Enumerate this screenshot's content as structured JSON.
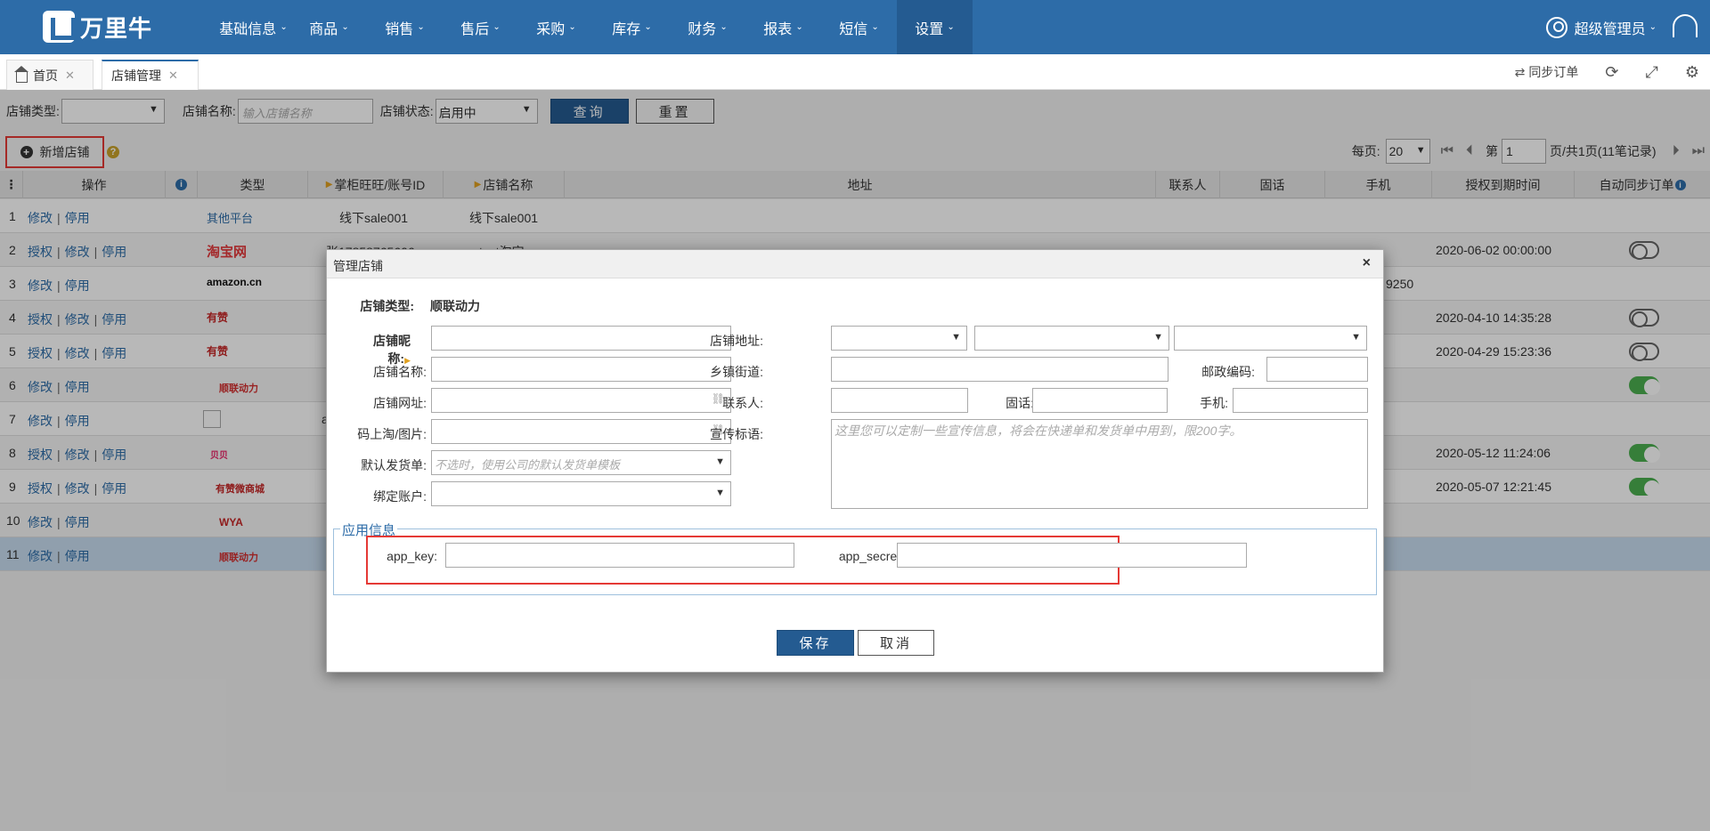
{
  "brand": {
    "name": "万里牛"
  },
  "nav": {
    "items": [
      {
        "label": "基础信息"
      },
      {
        "label": "商品"
      },
      {
        "label": "销售"
      },
      {
        "label": "售后"
      },
      {
        "label": "采购"
      },
      {
        "label": "库存"
      },
      {
        "label": "财务"
      },
      {
        "label": "报表"
      },
      {
        "label": "短信"
      },
      {
        "label": "设置"
      }
    ],
    "caret": "⌄",
    "user": "超级管理员"
  },
  "tabs": {
    "home": "首页",
    "active": "店铺管理",
    "close": "✕",
    "tools": {
      "sync": "同步订单",
      "refresh": "⟳",
      "fullscreen": "⤢",
      "settings": "⚙"
    }
  },
  "filter": {
    "type_label": "店铺类型:",
    "name_label": "店铺名称:",
    "name_placeholder": "输入店铺名称",
    "status_label": "店铺状态:",
    "status_value": "启用中",
    "query": "查询",
    "reset": "重置"
  },
  "toolbar": {
    "add": "新增店铺",
    "help": "?"
  },
  "pager": {
    "per_page_label": "每页:",
    "per_page": "20",
    "page_prefix": "第",
    "page": "1",
    "page_suffix": "页/共1页(11笔记录)",
    "first": "⏮",
    "prev": "⏴",
    "next": "⏵",
    "last": "⏭"
  },
  "table": {
    "headers": {
      "menu": "⋮",
      "ops": "操作",
      "info": "i",
      "type": "类型",
      "account": "掌柜旺旺/账号ID",
      "shop": "店铺名称",
      "addr": "地址",
      "contact": "联系人",
      "phone": "固话",
      "mobile": "手机",
      "expire": "授权到期时间",
      "autosync": "自动同步订单"
    },
    "op_labels": {
      "auth": "授权",
      "edit": "修改",
      "disable": "停用",
      "sep": "|"
    },
    "rows": [
      {
        "num": "1",
        "platform": "其他平台",
        "account": "线下sale001",
        "shop": "线下sale001",
        "expire": "",
        "mobile": ""
      },
      {
        "num": "2",
        "platform": "淘宝网",
        "account": "张17858765606",
        "shop": "test淘宝",
        "expire": "2020-06-02 00:00:00",
        "mobile": ""
      },
      {
        "num": "3",
        "platform": "amazon.cn",
        "account": "",
        "shop": "",
        "expire": "",
        "mobile": "9250"
      },
      {
        "num": "4",
        "platform": "有赞",
        "account": "",
        "shop": "",
        "expire": "2020-04-10 14:35:28",
        "mobile": ""
      },
      {
        "num": "5",
        "platform": "有赞",
        "account": "",
        "shop": "",
        "expire": "2020-04-29 15:23:36",
        "mobile": ""
      },
      {
        "num": "6",
        "platform": "顺联动力",
        "account": "",
        "shop": "",
        "expire": "",
        "mobile": ""
      },
      {
        "num": "7",
        "platform": "",
        "account": "a",
        "shop": "",
        "expire": "",
        "mobile": ""
      },
      {
        "num": "8",
        "platform": "贝贝",
        "account": "",
        "shop": "",
        "expire": "2020-05-12 11:24:06",
        "mobile": ""
      },
      {
        "num": "9",
        "platform": "有赞微商城",
        "account": "",
        "shop": "",
        "expire": "2020-05-07 12:21:45",
        "mobile": ""
      },
      {
        "num": "10",
        "platform": "WYA",
        "account": "",
        "shop": "",
        "expire": "",
        "mobile": ""
      },
      {
        "num": "11",
        "platform": "顺联动力",
        "account": "",
        "shop": "",
        "expire": "",
        "mobile": ""
      }
    ]
  },
  "dialog": {
    "title": "管理店铺",
    "close": "×",
    "type_label": "店铺类型:",
    "type_value": "顺联动力",
    "nick_label": "店铺昵称:",
    "name_label": "店铺名称:",
    "url_label": "店铺网址:",
    "qr_label": "码上淘/图片:",
    "invoice_label": "默认发货单:",
    "invoice_placeholder": "不选时，使用公司的默认发货单模板",
    "account_label": "绑定账户:",
    "addr_label": "店铺地址:",
    "street_label": "乡镇街道:",
    "zip_label": "邮政编码:",
    "contact_label": "联系人:",
    "phone_label": "固话:",
    "mobile_label": "手机:",
    "slogan_label": "宣传标语:",
    "slogan_placeholder": "这里您可以定制一些宣传信息，将会在快递单和发货单中用到，限200字。",
    "app_section": "应用信息",
    "app_key_label": "app_key:",
    "app_secret_label": "app_secret:",
    "save": "保存",
    "cancel": "取消",
    "link_glyph": "⛓"
  },
  "colors": {
    "nav": "#2d6ca8",
    "accent": "#245b91",
    "highlight": "#e53935",
    "toggle_on": "#4caf50"
  }
}
